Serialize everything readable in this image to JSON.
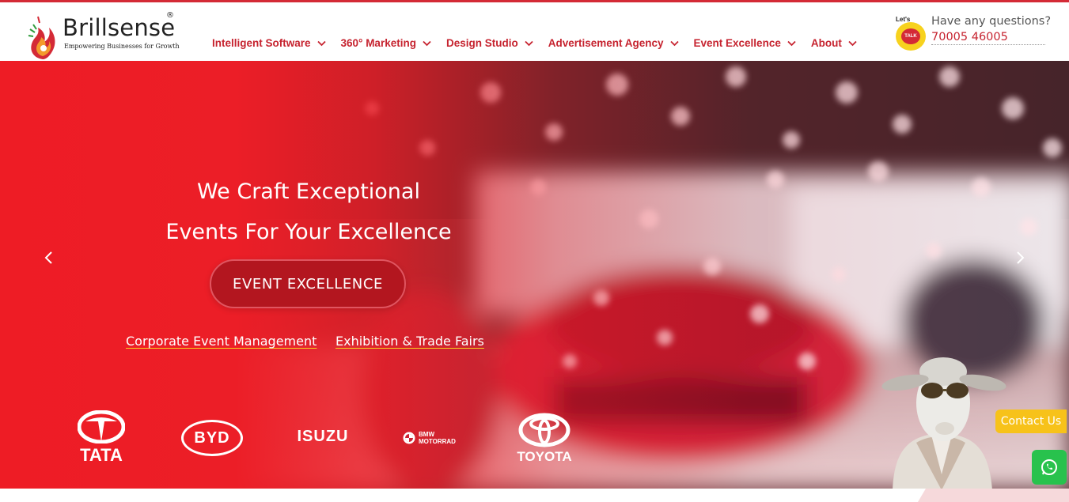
{
  "brand": {
    "name": "Brillsense",
    "registered": "®",
    "tagline": "Empowering Businesses for Growth"
  },
  "nav": {
    "items": [
      {
        "label": "Intelligent Software"
      },
      {
        "label": "360° Marketing"
      },
      {
        "label": "Design Studio"
      },
      {
        "label": "Advertisement Agency"
      },
      {
        "label": "Event Excellence"
      },
      {
        "label": "About"
      }
    ]
  },
  "contact_header": {
    "badge_top": "Let's",
    "badge_main": "TALK",
    "question": "Have any questions?",
    "phone": "70005 46005"
  },
  "hero": {
    "headline_line1": "We Craft Exceptional",
    "headline_line2": "Events For Your Excellence",
    "cta_label": "EVENT EXCELLENCE",
    "links": [
      "Corporate Event Management",
      "Exhibition & Trade Fairs"
    ]
  },
  "clients": [
    {
      "name": "TATA",
      "icon": "tata-logo"
    },
    {
      "name": "BYD",
      "icon": "byd-logo"
    },
    {
      "name": "ISUZU",
      "icon": "isuzu-logo"
    },
    {
      "name_line1": "BMW",
      "name_line2": "MOTORRAD",
      "icon": "bmw-motorrad-logo"
    },
    {
      "name": "TOYOTA",
      "icon": "toyota-logo"
    }
  ],
  "floating": {
    "contact_label": "Contact Us",
    "whatsapp_icon": "whatsapp-icon",
    "mascot_icon": "sheep-mascot"
  },
  "colors": {
    "brand_red": "#d42a36",
    "hero_red": "#ee1c25",
    "cta_red": "#b3161f",
    "accent_yellow": "#f7c21a",
    "whatsapp_green": "#28c24d"
  }
}
